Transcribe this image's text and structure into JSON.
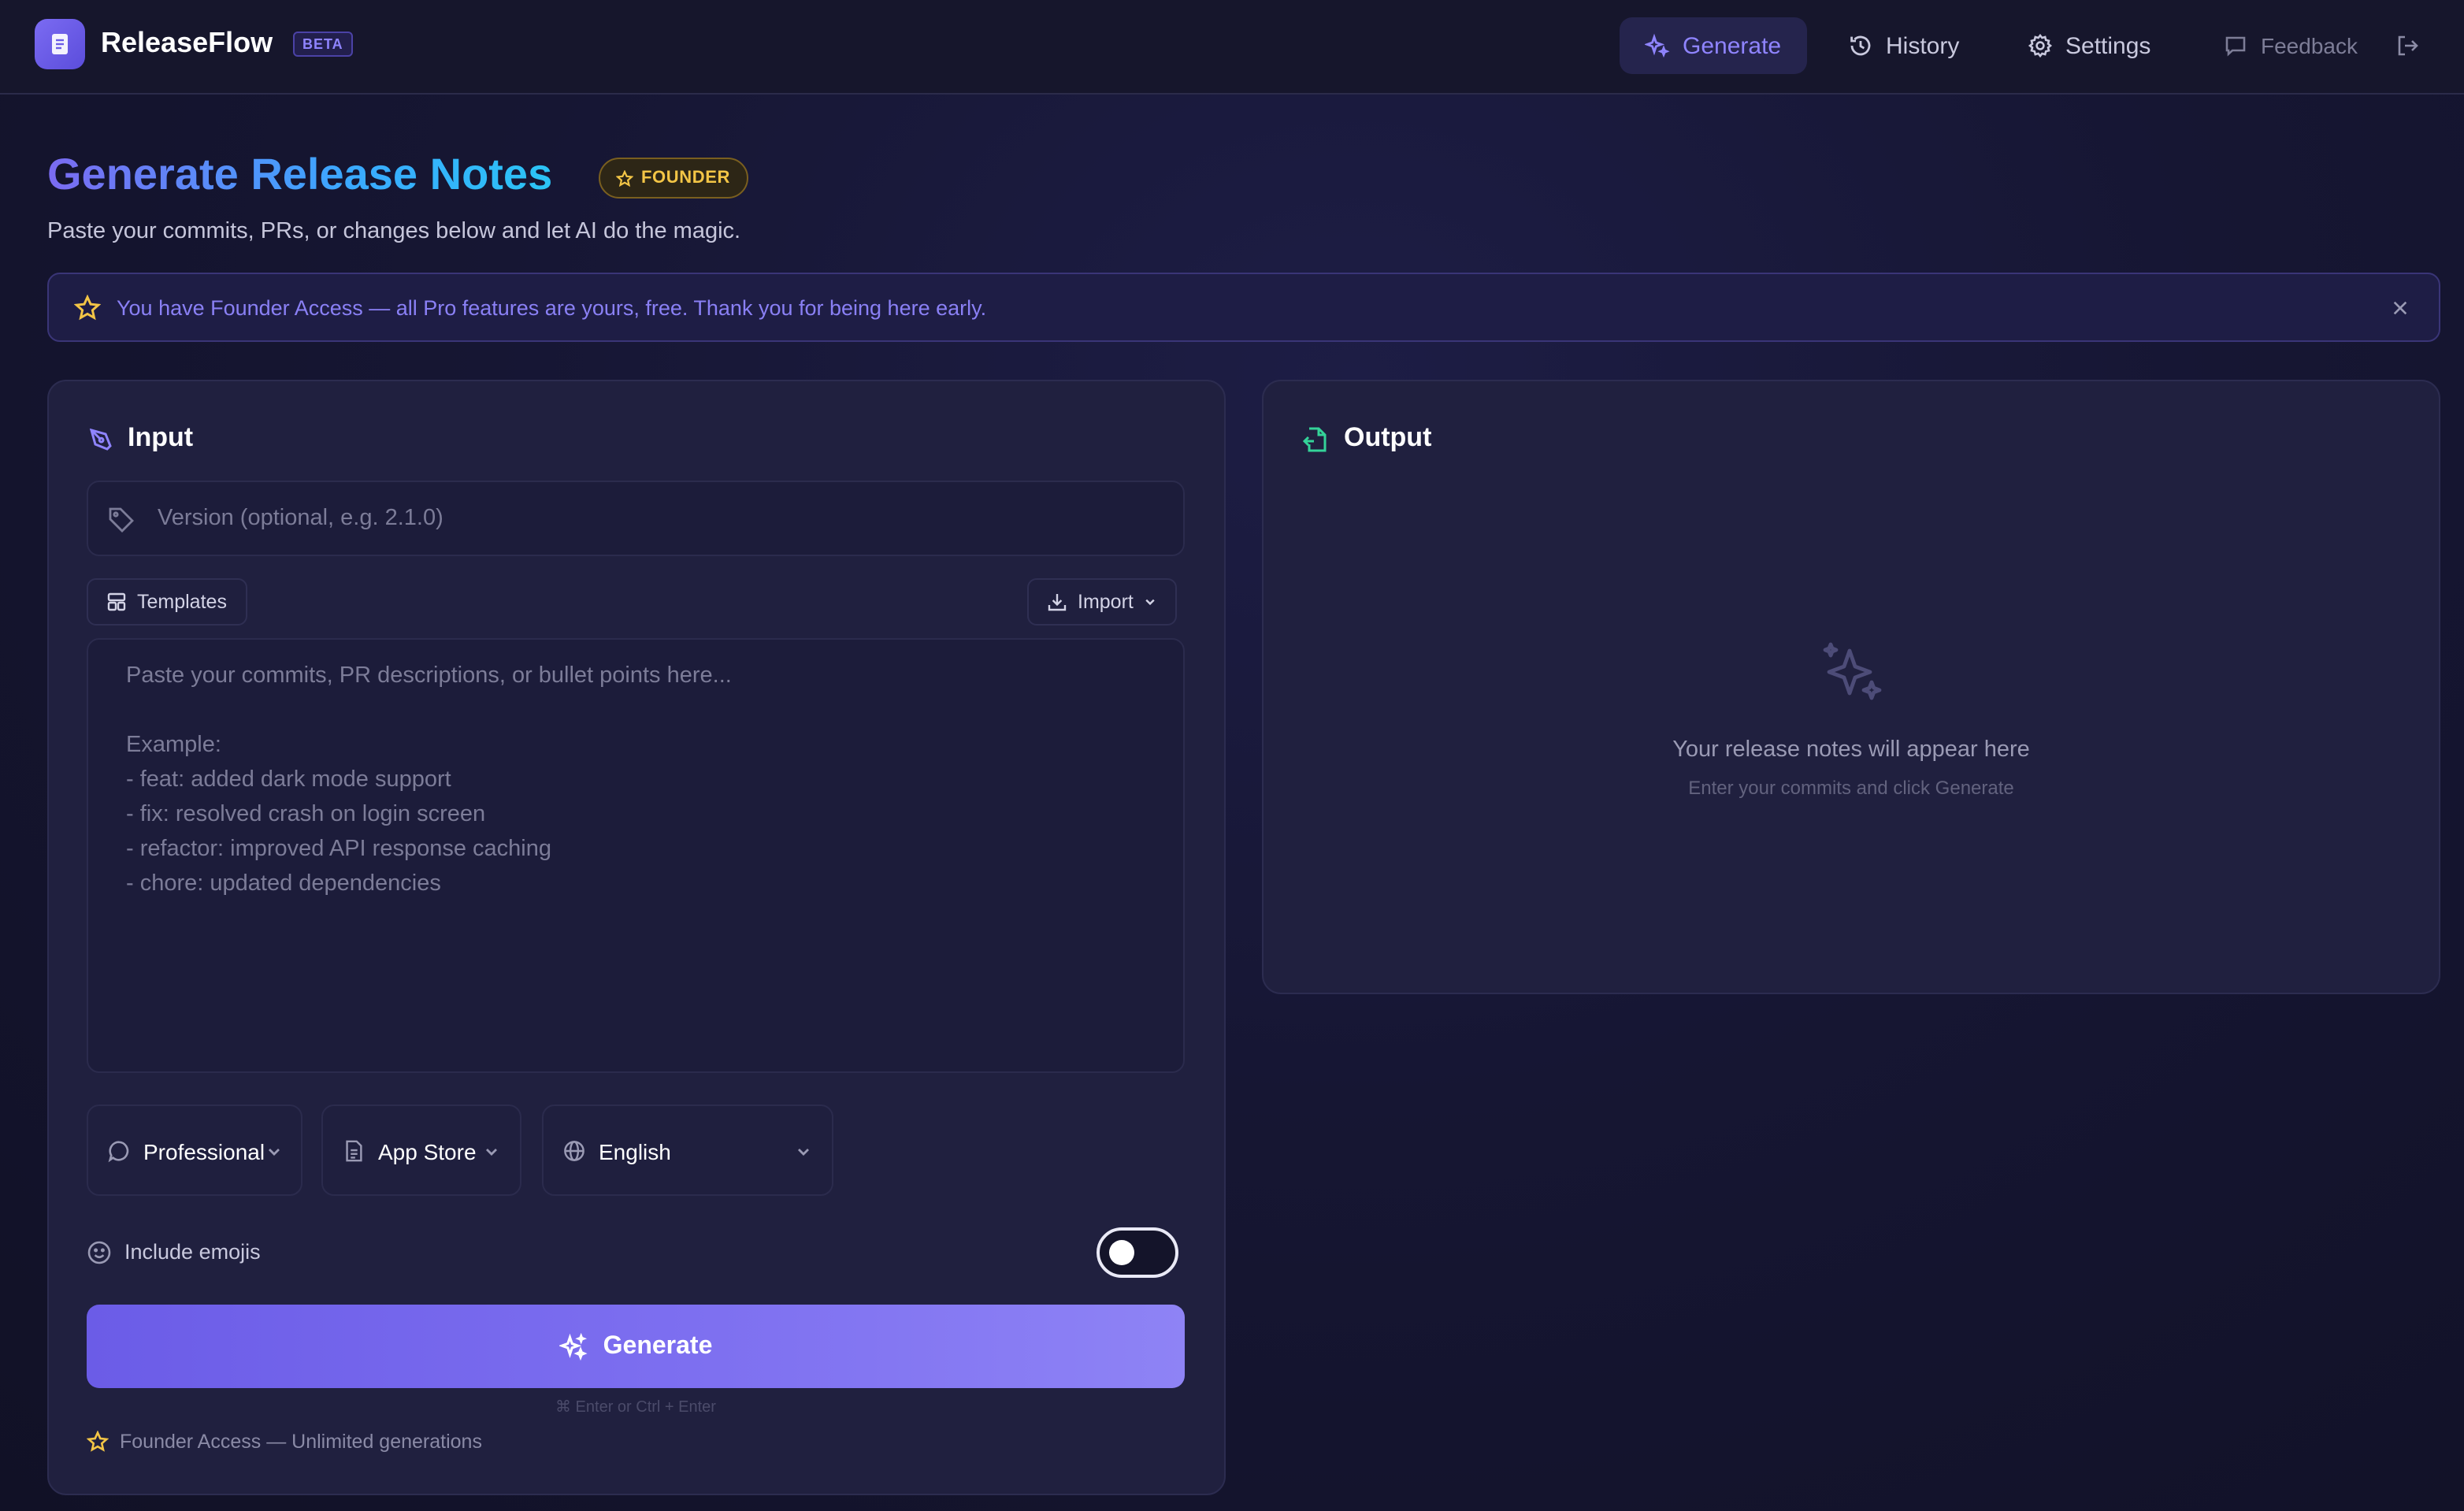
{
  "header": {
    "brand": "ReleaseFlow",
    "badge": "BETA",
    "nav": {
      "generate": "Generate",
      "history": "History",
      "settings": "Settings",
      "feedback": "Feedback"
    }
  },
  "page": {
    "title": "Generate Release Notes",
    "founder_badge": "FOUNDER",
    "subtitle": "Paste your commits, PRs, or changes below and let AI do the magic."
  },
  "banner": {
    "text": "You have Founder Access — all Pro features are yours, free. Thank you for being here early."
  },
  "input": {
    "title": "Input",
    "version_placeholder": "Version (optional, e.g. 2.1.0)",
    "version_value": "",
    "templates_label": "Templates",
    "import_label": "Import",
    "commits_placeholder": "Paste your commits, PR descriptions, or bullet points here...\n\nExample:\n- feat: added dark mode support\n- fix: resolved crash on login screen\n- refactor: improved API response caching\n- chore: updated dependencies",
    "tone": "Professional",
    "format": "App Store",
    "language": "English",
    "emoji_label": "Include emojis",
    "emoji_enabled": false,
    "generate_label": "Generate",
    "shortcut_hint": "⌘ Enter  or  Ctrl + Enter",
    "founder_note": "Founder Access — Unlimited generations"
  },
  "output": {
    "title": "Output",
    "empty_title": "Your release notes will appear here",
    "empty_subtitle": "Enter your commits and click Generate"
  },
  "colors": {
    "accent": "#7b6bf2",
    "founder_gold": "#f3c546",
    "output_icon": "#34d399",
    "background": "#161633"
  }
}
